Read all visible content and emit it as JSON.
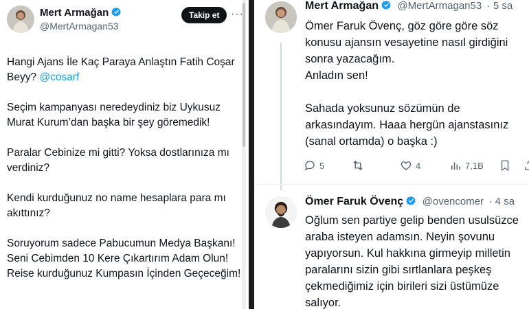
{
  "left_tweet": {
    "author_name": "Mert Armağan",
    "author_handle": "@MertArmagan53",
    "follow_label": "Takip et",
    "more_label": "···",
    "paragraphs": [
      {
        "text": "Hangi Ajans İle Kaç Paraya Anlaştın Fatih Coşar Beyy? ",
        "mention": "@cosarf"
      },
      {
        "text": "Seçim kampanyası neredeydiniz biz Uykusuz Murat Kurum’dan başka bir şey göremedik!"
      },
      {
        "text": "Paralar Cebinize mi gitti? Yoksa dostlarınıza mı verdiniz?"
      },
      {
        "text": "Kendi kurduğunuz no name hesaplara para mı akıttınız?"
      },
      {
        "text": "Soruyorum sadece Pabucumun Medya Başkanı! Seni Cebimden 10 Kere Çıkartırım Adam Olun! Reise kurduğunuz Kumpasın İçinden Geçeceğim!"
      }
    ]
  },
  "right_tweet_1": {
    "author_name": "Mert Armağan",
    "author_handle": "@MertArmagan53",
    "time": "· 5 sa",
    "paragraphs": [
      "Ömer Faruk Övenç, göz göre göre söz konusu ajansın vesayetine nasıl girdiğini sonra yazacağım.",
      "Anladın sen!",
      "",
      "Sahada yoksunuz sözümün de arkasındayım. Haaa hergün ajanstasınız (sanal ortamda) o başka :)"
    ],
    "actions": {
      "replies": "5",
      "retweets": "",
      "likes": "4",
      "views": "7,1B"
    }
  },
  "right_tweet_2": {
    "author_name": "Ömer Faruk Övenç",
    "author_handle": "@ovencomer",
    "time": "· 4 sa",
    "text": "Oğlum sen partiye gelip benden usulsüzce araba isteyen adamsın. Neyin şovunu yapıyorsun. Kul hakkına girmeyip milletin paralarını sizin gibi sırtlanlara peşkeş çekmediğimiz için birileri sizi üstümüze salıyor."
  },
  "colors": {
    "text": "#0f1419",
    "secondary": "#536471",
    "link": "#1d9bf0",
    "verified": "#1d9bf0",
    "divider": "#1c1c1c"
  }
}
